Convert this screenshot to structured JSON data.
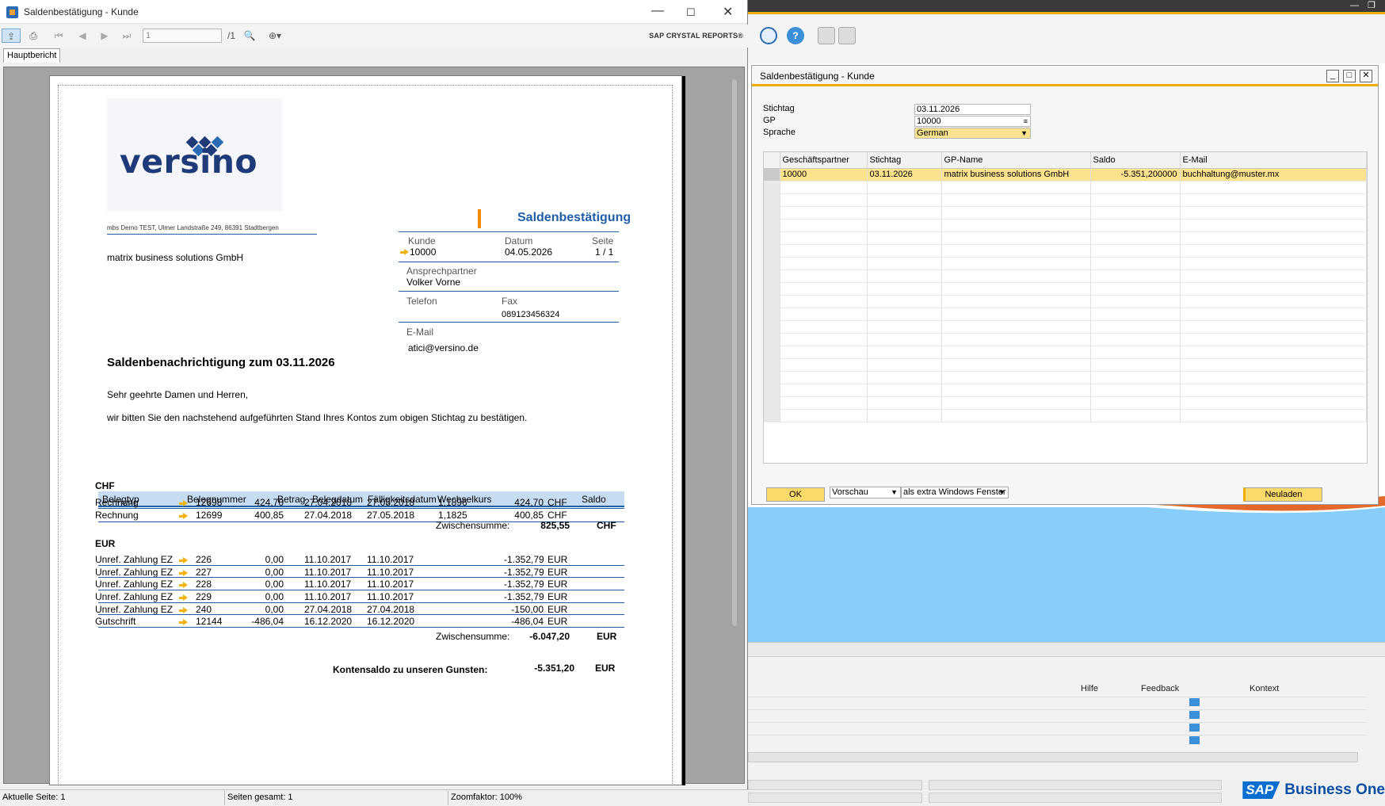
{
  "report_window": {
    "title": "Saldenbestätigung - Kunde",
    "page_input": "1",
    "page_total": "/1",
    "brand": "SAP CRYSTAL REPORTS®",
    "tab_label": "Hauptbericht",
    "status": {
      "current_page": "Aktuelle Seite: 1",
      "total_pages": "Seiten gesamt: 1",
      "zoom": "Zoomfaktor: 100%"
    }
  },
  "report": {
    "logo_text": "versino",
    "sender_line": "mbs Demo TEST, Ulmer Landstraße 249, 86391 Stadtbergen",
    "recipient": "matrix business solutions GmbH",
    "doc_title": "Saldenbestätigung",
    "kunde_label": "Kunde",
    "kunde_value": "10000",
    "datum_label": "Datum",
    "datum_value": "04.05.2026",
    "seite_label": "Seite",
    "seite_value": "1 / 1",
    "ansprech_label": "Ansprechpartner",
    "ansprech_value": "Volker  Vorne",
    "telefon_label": "Telefon",
    "fax_label": "Fax",
    "fax_value": "089123456324",
    "email_label": "E-Mail",
    "email_value": "atici@versino.de",
    "heading": "Saldenbenachrichtigung zum 03.11.2026",
    "greeting": "Sehr geehrte Damen und Herren,",
    "body_text": "wir bitten Sie den nachstehend aufgeführten Stand Ihres Kontos zum obigen Stichtag zu bestätigen.",
    "columns": [
      "Belegtyp",
      "Belegnummer",
      "Betrag",
      "Belegdatum",
      "Fälligkeitsdatum",
      "Wechselkurs",
      "Saldo"
    ],
    "groups": [
      {
        "currency": "CHF",
        "rows": [
          {
            "typ": "Rechnung",
            "nr": "12698",
            "betrag": "424,70",
            "belegdatum": "27.04.2018",
            "faellig": "27.05.2018",
            "kurs": "1,1896",
            "saldo": "424,70",
            "cur": "CHF"
          },
          {
            "typ": "Rechnung",
            "nr": "12699",
            "betrag": "400,85",
            "belegdatum": "27.04.2018",
            "faellig": "27.05.2018",
            "kurs": "1,1825",
            "saldo": "400,85",
            "cur": "CHF"
          }
        ],
        "subtotal_label": "Zwischensumme:",
        "subtotal": "825,55",
        "subtotal_cur": "CHF"
      },
      {
        "currency": "EUR",
        "rows": [
          {
            "typ": "Unref. Zahlung EZ",
            "nr": "226",
            "betrag": "0,00",
            "belegdatum": "11.10.2017",
            "faellig": "11.10.2017",
            "kurs": "",
            "saldo": "-1.352,79",
            "cur": "EUR"
          },
          {
            "typ": "Unref. Zahlung EZ",
            "nr": "227",
            "betrag": "0,00",
            "belegdatum": "11.10.2017",
            "faellig": "11.10.2017",
            "kurs": "",
            "saldo": "-1.352,79",
            "cur": "EUR"
          },
          {
            "typ": "Unref. Zahlung EZ",
            "nr": "228",
            "betrag": "0,00",
            "belegdatum": "11.10.2017",
            "faellig": "11.10.2017",
            "kurs": "",
            "saldo": "-1.352,79",
            "cur": "EUR"
          },
          {
            "typ": "Unref. Zahlung EZ",
            "nr": "229",
            "betrag": "0,00",
            "belegdatum": "11.10.2017",
            "faellig": "11.10.2017",
            "kurs": "",
            "saldo": "-1.352,79",
            "cur": "EUR"
          },
          {
            "typ": "Unref. Zahlung EZ",
            "nr": "240",
            "betrag": "0,00",
            "belegdatum": "27.04.2018",
            "faellig": "27.04.2018",
            "kurs": "",
            "saldo": "-150,00",
            "cur": "EUR"
          },
          {
            "typ": "Gutschrift",
            "nr": "12144",
            "betrag": "-486,04",
            "belegdatum": "16.12.2020",
            "faellig": "16.12.2020",
            "kurs": "",
            "saldo": "-486,04",
            "cur": "EUR"
          }
        ],
        "subtotal_label": "Zwischensumme:",
        "subtotal": "-6.047,20",
        "subtotal_cur": "EUR"
      }
    ],
    "total_label": "Kontensaldo zu unseren Gunsten:",
    "total": "-5.351,20",
    "total_cur": "EUR"
  },
  "sap_dialog": {
    "title": "Saldenbestätigung - Kunde",
    "stichtag_label": "Stichtag",
    "stichtag_value": "03.11.2026",
    "gp_label": "GP",
    "gp_value": "10000",
    "sprache_label": "Sprache",
    "sprache_value": "German",
    "grid_columns": [
      "Geschäftspartner",
      "Stichtag",
      "GP-Name",
      "Saldo",
      "E-Mail"
    ],
    "grid_rows": [
      {
        "gp": "10000",
        "stichtag": "03.11.2026",
        "name": "matrix business solutions GmbH",
        "saldo": "-5.351,200000",
        "email": "buchhaltung@muster.mx"
      }
    ],
    "ok_label": "OK",
    "output_select": "Vorschau",
    "window_select": "als extra Windows Fenster",
    "reload_label": "Neuladen"
  },
  "sap_bottom": {
    "columns": [
      "Hilfe",
      "Feedback",
      "Kontext"
    ]
  },
  "sap_brand": {
    "mark": "SAP",
    "product": "Business One"
  },
  "colors": {
    "accent": "#f0ab00",
    "report_blue": "#1f5fa8",
    "selection": "#fbe38e",
    "workspace": "#87cffa"
  }
}
